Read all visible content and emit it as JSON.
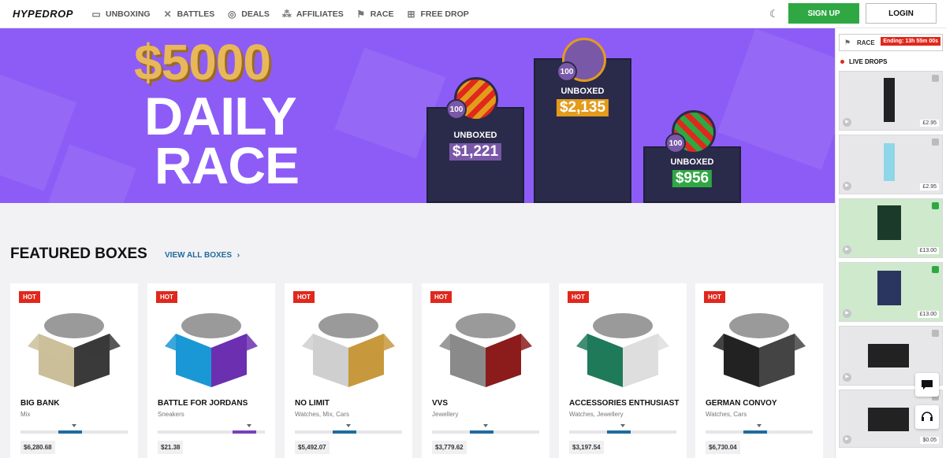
{
  "header": {
    "logo": "HYPEDROP",
    "nav": [
      {
        "label": "UNBOXING",
        "icon": "box-icon"
      },
      {
        "label": "BATTLES",
        "icon": "swords-icon"
      },
      {
        "label": "DEALS",
        "icon": "deals-icon"
      },
      {
        "label": "AFFILIATES",
        "icon": "affiliates-icon"
      },
      {
        "label": "RACE",
        "icon": "race-flag-icon"
      },
      {
        "label": "FREE DROP",
        "icon": "gift-icon"
      }
    ],
    "signup_label": "SIGN UP",
    "login_label": "LOGIN"
  },
  "hero": {
    "line1": "$5000",
    "line2": "DAILY",
    "line3": "RACE",
    "podiums": [
      {
        "label": "UNBOXED",
        "amount": "$1,221",
        "coin_count": "100",
        "accent": "#7a58a8"
      },
      {
        "label": "UNBOXED",
        "amount": "$2,135",
        "coin_count": "100",
        "accent": "#e39b1b"
      },
      {
        "label": "UNBOXED",
        "amount": "$956",
        "coin_count": "100",
        "accent": "#2fa843"
      }
    ]
  },
  "featured": {
    "title": "FEATURED BOXES",
    "view_all": "VIEW ALL BOXES",
    "boxes": [
      {
        "badge": "HOT",
        "name": "BIG BANK",
        "category": "Mix",
        "price": "$6,280.68",
        "value_fraction": 0.5
      },
      {
        "badge": "HOT",
        "name": "BATTLE FOR JORDANS",
        "category": "Sneakers",
        "price": "$21.38",
        "value_fraction": 0.85
      },
      {
        "badge": "HOT",
        "name": "NO LIMIT",
        "category": "Watches, Mix, Cars",
        "price": "$5,492.07",
        "value_fraction": 0.5
      },
      {
        "badge": "HOT",
        "name": "VVS",
        "category": "Jewellery",
        "price": "$3,779.62",
        "value_fraction": 0.5
      },
      {
        "badge": "HOT",
        "name": "ACCESSORIES ENTHUSIAST",
        "category": "Watches, Jewellery",
        "price": "$3,197.54",
        "value_fraction": 0.5
      },
      {
        "badge": "HOT",
        "name": "GERMAN CONVOY",
        "category": "Watches, Cars",
        "price": "$6,730.04",
        "value_fraction": 0.5
      }
    ]
  },
  "sidebar": {
    "race_label": "RACE",
    "race_ending": "Ending: 13h 55m 00s",
    "live_title": "LIVE DROPS",
    "drops": [
      {
        "price": "£2.95",
        "bg": "grey"
      },
      {
        "price": "£2.95",
        "bg": "grey"
      },
      {
        "price": "£13.00",
        "bg": "green"
      },
      {
        "price": "£13.00",
        "bg": "green"
      },
      {
        "price": "",
        "bg": "grey"
      },
      {
        "price": "$0.05",
        "bg": "grey"
      }
    ]
  },
  "colors": {
    "brand_purple": "#8d5cf6",
    "signup_green": "#2fa843",
    "hot_red": "#e0281d",
    "link_blue": "#1f6b9c"
  }
}
